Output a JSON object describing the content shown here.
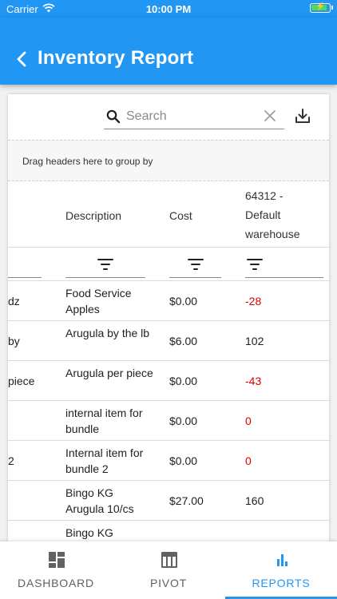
{
  "status_bar": {
    "carrier": "Carrier",
    "time": "10:00 PM"
  },
  "header": {
    "title": "Inventory Report"
  },
  "search": {
    "placeholder": "Search"
  },
  "group_panel": {
    "text": "Drag headers here to group by"
  },
  "table": {
    "columns": [
      "Description",
      "Cost",
      "64312 - Default warehouse"
    ],
    "column_lines": [
      "64312 -",
      "Default",
      "warehouse"
    ],
    "rows": [
      {
        "name": "dz",
        "desc": "Food Service Apples",
        "cost": "$0.00",
        "qty": "-28",
        "negative": true
      },
      {
        "name": "by",
        "desc": "Arugula by the lb",
        "cost": "$6.00",
        "qty": "102",
        "negative": false
      },
      {
        "name": "piece",
        "desc": "Arugula per piece",
        "cost": "$0.00",
        "qty": "-43",
        "negative": true
      },
      {
        "name": "",
        "desc": "internal item for bundle",
        "cost": "$0.00",
        "qty": "0",
        "negative": true
      },
      {
        "name": "2",
        "desc": "Internal item for bundle 2",
        "cost": "$0.00",
        "qty": "0",
        "negative": true
      },
      {
        "name": "",
        "desc": "Bingo KG Arugula 10/cs",
        "cost": "$27.00",
        "qty": "160",
        "negative": false
      },
      {
        "name": "",
        "desc": "Bingo KG",
        "cost": "",
        "qty": "",
        "negative": false
      }
    ]
  },
  "nav": {
    "dashboard": "DASHBOARD",
    "pivot": "PIVOT",
    "reports": "REPORTS"
  },
  "colors": {
    "primary": "#2196f3",
    "negative": "#e00000"
  }
}
